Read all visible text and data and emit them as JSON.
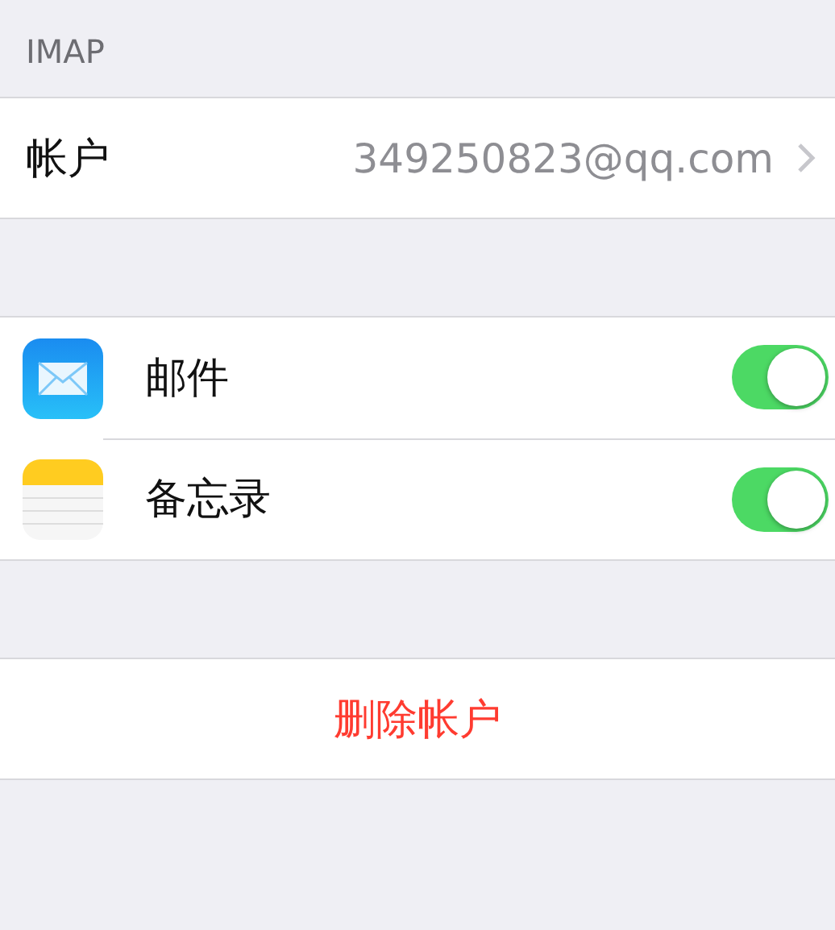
{
  "section_header": "IMAP",
  "account_row": {
    "label": "帐户",
    "value": "349250823@qq.com"
  },
  "sync_items": [
    {
      "kind": "mail",
      "label": "邮件",
      "on": true
    },
    {
      "kind": "notes",
      "label": "备忘录",
      "on": true
    }
  ],
  "delete_button": "删除帐户"
}
